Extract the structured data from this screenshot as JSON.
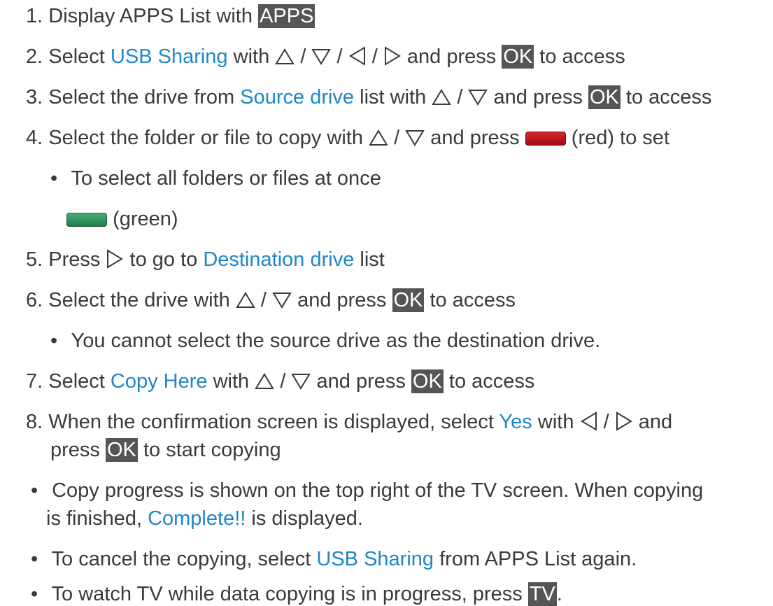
{
  "steps": [
    {
      "n": "1.",
      "t1": "Display APPS List with",
      "key": "APPS"
    },
    {
      "n": "2.",
      "t1": "Select",
      "hl": "USB Sharing",
      "t2": "with",
      "t3": "and press",
      "key": "OK",
      "t4": "to access"
    },
    {
      "n": "3.",
      "t1": "Select the drive from",
      "hl": "Source drive",
      "t2": "list with",
      "t3": "and press",
      "key": "OK",
      "t4": "to access"
    },
    {
      "n": "4.",
      "t1": "Select the folder or file to copy with",
      "t2": "and press",
      "t3": "(red) to set",
      "sub1": "To select all folders or files at once",
      "sub2": "(green)"
    },
    {
      "n": "5.",
      "t1": "Press",
      "t2": "to go to",
      "hl": "Destination drive",
      "t3": "list"
    },
    {
      "n": "6.",
      "t1": "Select the drive with",
      "t2": "and press",
      "key": "OK",
      "t3": "to access",
      "sub1": "You cannot select the source drive as the destination drive."
    },
    {
      "n": "7.",
      "t1": "Select",
      "hl": "Copy Here",
      "t2": "with",
      "t3": "and press",
      "key": "OK",
      "t4": "to access"
    },
    {
      "n": "8.",
      "t1": "When the confirmation screen is displayed, select",
      "hl": "Yes",
      "t2": "with",
      "t3": "and",
      "t4": "press",
      "key": "OK",
      "t5": "to start copying"
    }
  ],
  "notes": [
    {
      "t1": "Copy progress is shown on the top right of the TV screen. When copying",
      "t2": "is finished,",
      "hl": "Complete!!",
      "t3": "is displayed."
    },
    {
      "t1": "To cancel the copying, select",
      "hl": "USB Sharing",
      "t2": "from APPS List again."
    },
    {
      "t1": "To watch TV while data copying is in progress, press",
      "key": "TV",
      "t2": "."
    }
  ],
  "symbols": {
    "slash": "/",
    "bullet": "•"
  },
  "colors": {
    "text": "#3a3a3a",
    "link": "#1f86c8",
    "key_bg": "#555555",
    "red_button": "#c0151b",
    "green_button": "#2e9a5e"
  },
  "icons": [
    "up-triangle-icon",
    "down-triangle-icon",
    "left-triangle-icon",
    "right-triangle-icon",
    "red-button-icon",
    "green-button-icon"
  ]
}
